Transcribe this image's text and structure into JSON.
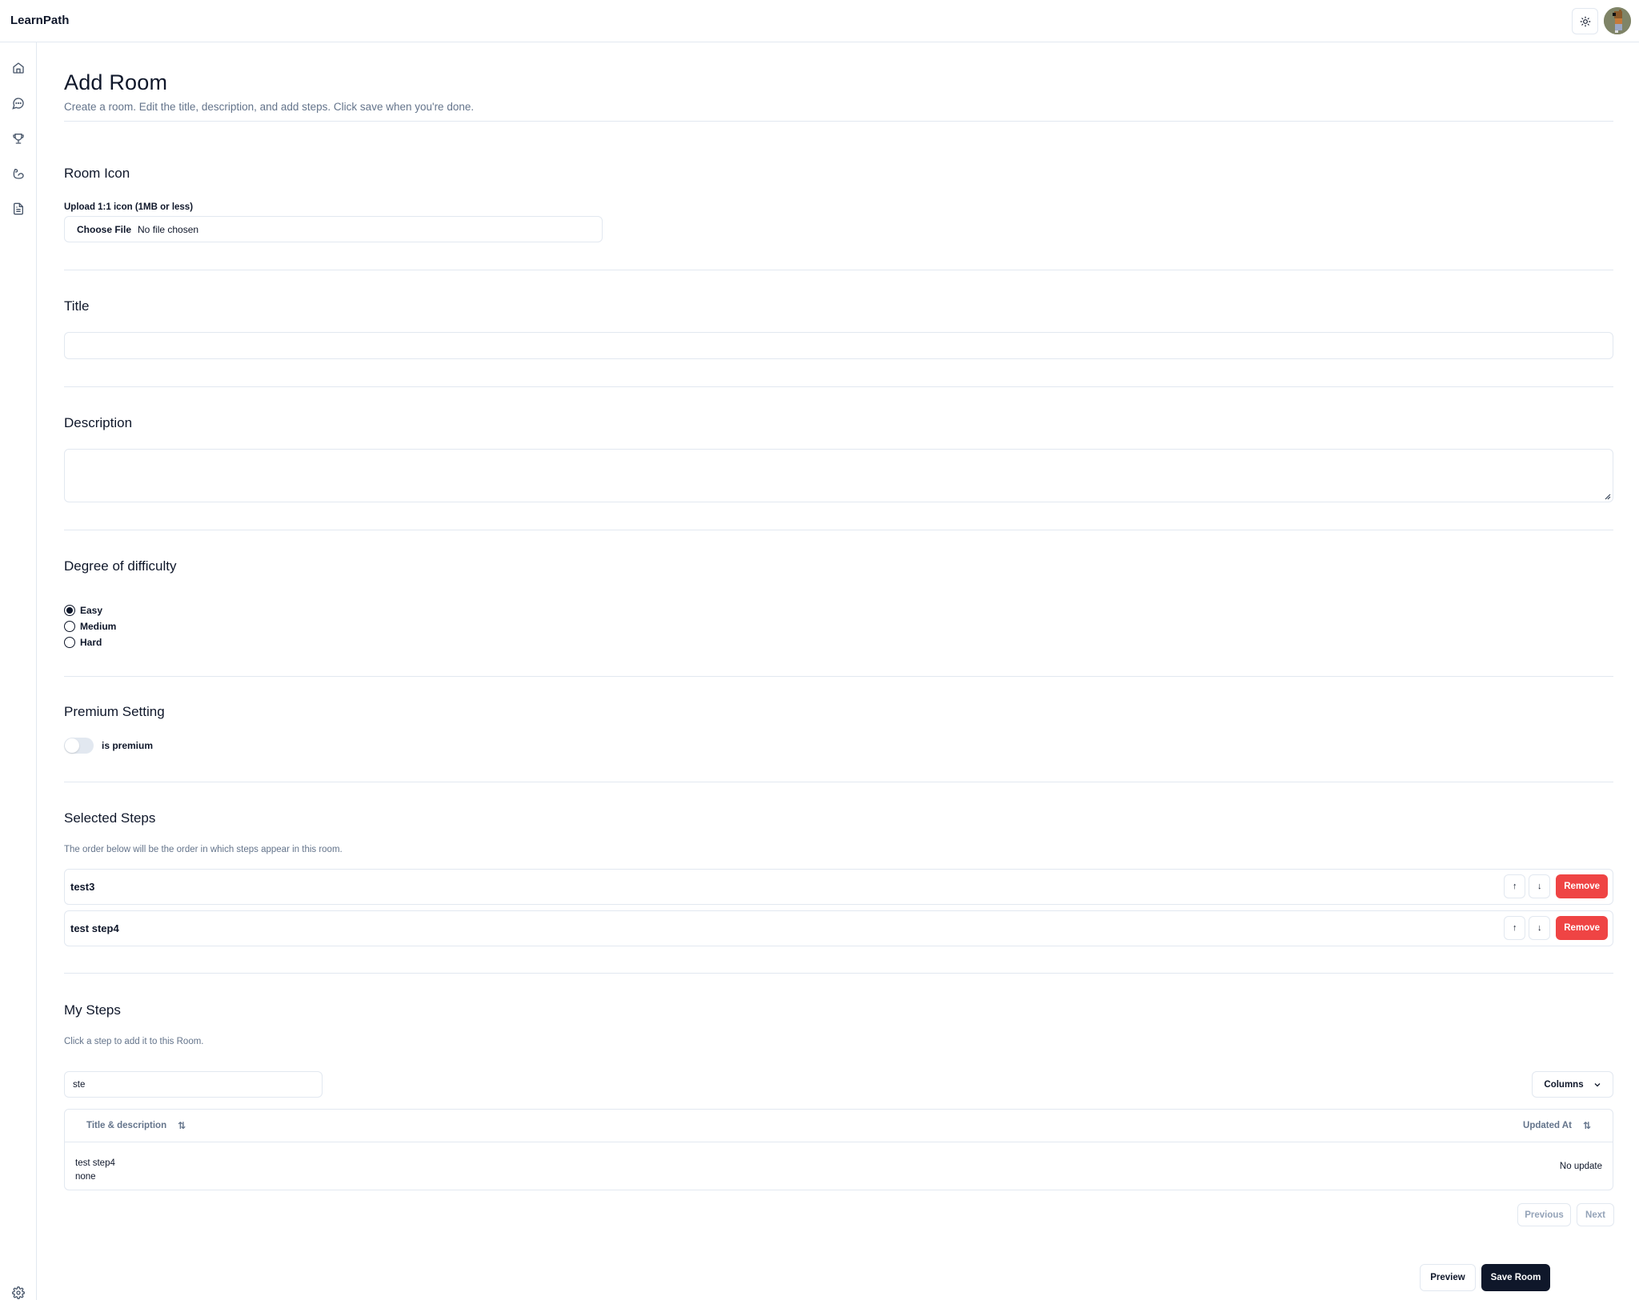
{
  "app": {
    "brand": "LearnPath",
    "theme_toggle_icon": "sun-icon",
    "avatar_alt": "user avatar"
  },
  "sidebar": {
    "items": [
      {
        "name": "home",
        "icon": "home-icon"
      },
      {
        "name": "chat",
        "icon": "message-circle-icon"
      },
      {
        "name": "trophy",
        "icon": "trophy-icon"
      },
      {
        "name": "strength",
        "icon": "biceps-icon"
      },
      {
        "name": "document",
        "icon": "file-text-icon"
      }
    ],
    "footer_icon": "settings-icon"
  },
  "page": {
    "title": "Add Room",
    "subtitle": "Create a room. Edit the title, description, and add steps. Click save when you're done."
  },
  "room_icon": {
    "heading": "Room Icon",
    "upload_label": "Upload 1:1 icon (1MB or less)",
    "choose_file_label": "Choose File",
    "file_status": "No file chosen"
  },
  "title_section": {
    "heading": "Title",
    "value": ""
  },
  "description_section": {
    "heading": "Description",
    "value": ""
  },
  "difficulty": {
    "heading": "Degree of difficulty",
    "options": [
      {
        "label": "Easy",
        "checked": true
      },
      {
        "label": "Medium",
        "checked": false
      },
      {
        "label": "Hard",
        "checked": false
      }
    ]
  },
  "premium": {
    "heading": "Premium Setting",
    "toggle_label": "is premium",
    "enabled": false
  },
  "selected_steps": {
    "heading": "Selected Steps",
    "note": "The order below will be the order in which steps appear in this room.",
    "move_up_label": "↑",
    "move_down_label": "↓",
    "remove_label": "Remove",
    "items": [
      {
        "title": "test3"
      },
      {
        "title": "test step4"
      }
    ]
  },
  "my_steps": {
    "heading": "My Steps",
    "note": "Click a step to add it to this Room.",
    "search_value": "ste",
    "columns_label": "Columns",
    "columns": [
      {
        "label": "Title & description",
        "sort_icon": "⇅"
      },
      {
        "label": "Updated At",
        "sort_icon": "⇅"
      }
    ],
    "rows": [
      {
        "title": "test step4",
        "description": "none",
        "updated_at": "No update"
      }
    ],
    "pagination": {
      "previous_label": "Previous",
      "next_label": "Next"
    }
  },
  "footer_actions": {
    "preview_label": "Preview",
    "save_label": "Save Room"
  },
  "colors": {
    "primary": "#0f172a",
    "danger": "#ef4444",
    "muted_text": "#64748b",
    "border": "#e2e8f0"
  }
}
